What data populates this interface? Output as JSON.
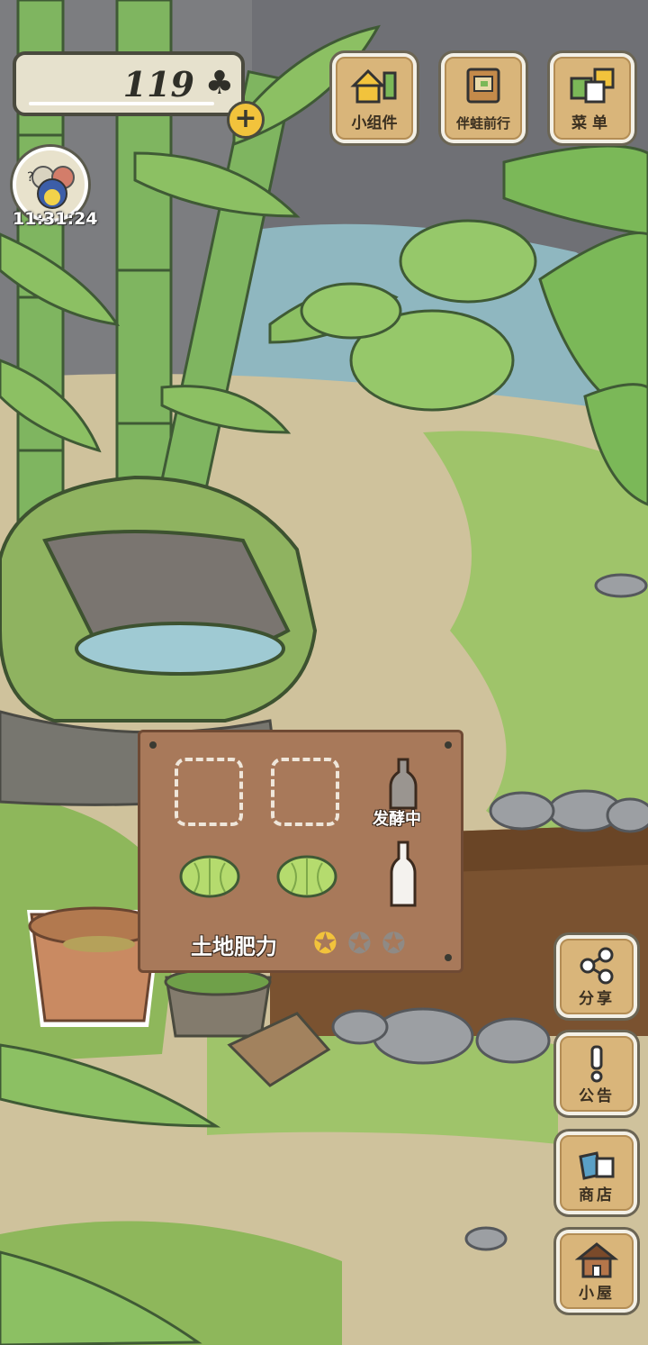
{
  "currency": {
    "amount": "119",
    "icon": "clover-icon"
  },
  "time": "11:31:24",
  "top_buttons": [
    {
      "label": "小组件",
      "icon": "widget-icon"
    },
    {
      "label": "伴蛙前行",
      "icon": "book-icon"
    },
    {
      "label": "菜单",
      "icon": "menu-cards-icon"
    }
  ],
  "side_buttons": [
    {
      "label": "分享",
      "icon": "share-icon"
    },
    {
      "label": "公告",
      "icon": "exclamation-icon"
    },
    {
      "label": "商店",
      "icon": "shop-bags-icon"
    },
    {
      "label": "小屋",
      "icon": "house-icon"
    }
  ],
  "garden": {
    "status_label": "发酵中",
    "soil_label": "土地肥力",
    "soil_fertility": 1,
    "soil_fertility_max": 3,
    "plots": [
      {
        "state": "empty"
      },
      {
        "state": "empty"
      },
      {
        "state": "fermenting-bottle"
      },
      {
        "state": "cabbage"
      },
      {
        "state": "cabbage"
      },
      {
        "state": "bottle"
      }
    ]
  }
}
